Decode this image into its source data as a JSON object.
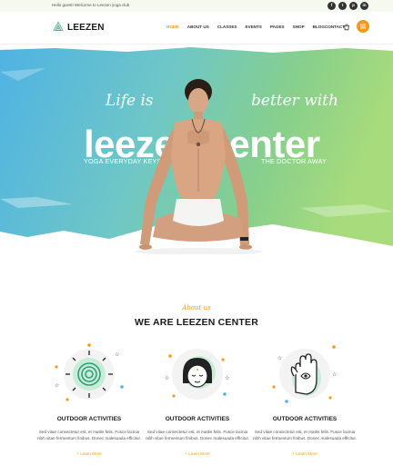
{
  "topbar": {
    "greeting": "Hello guest! Welcome to Leezen yoga club",
    "social": [
      "f",
      "t",
      "p",
      "in"
    ]
  },
  "header": {
    "logo_text": "LEEZEN",
    "nav": [
      "HOME",
      "ABOUT US",
      "CLASSES",
      "EVENTS",
      "PAGES",
      "SHOP",
      "BLOG",
      "CONTACT"
    ],
    "active_nav": "HOME",
    "accent_color": "#f39a1a"
  },
  "hero": {
    "script_left": "Life is",
    "script_right": "better with",
    "title": "leezen center",
    "tagline_left": "YOGA EVERYDAY KEYS",
    "tagline_right": "THE DOCTOR AWAY"
  },
  "about": {
    "script": "About us",
    "title": "WE ARE LEEZEN CENTER",
    "features": [
      {
        "icon": "spiral-sun-icon",
        "title": "OUTDOOR ACTIVITIES",
        "text": "Sed vitae consectetur est, et mattis felis. Fusce lacinia nibh vitae fermentum finibus. Donec malesuada efficitur.",
        "more": "+ Learn More"
      },
      {
        "icon": "meditation-face-icon",
        "title": "OUTDOOR ACTIVITIES",
        "text": "Sed vitae consectetur est, et mattis felis. Fusce lacinia nibh vitae fermentum finibus. Donec malesuada efficitur.",
        "more": "+ Learn More"
      },
      {
        "icon": "hamsa-hand-icon",
        "title": "OUTDOOR ACTIVITIES",
        "text": "Sed vitae consectetur est, et mattis felis. Fusce lacinia nibh vitae fermentum finibus. Donec malesuada efficitur.",
        "more": "+ Learn More"
      }
    ]
  }
}
